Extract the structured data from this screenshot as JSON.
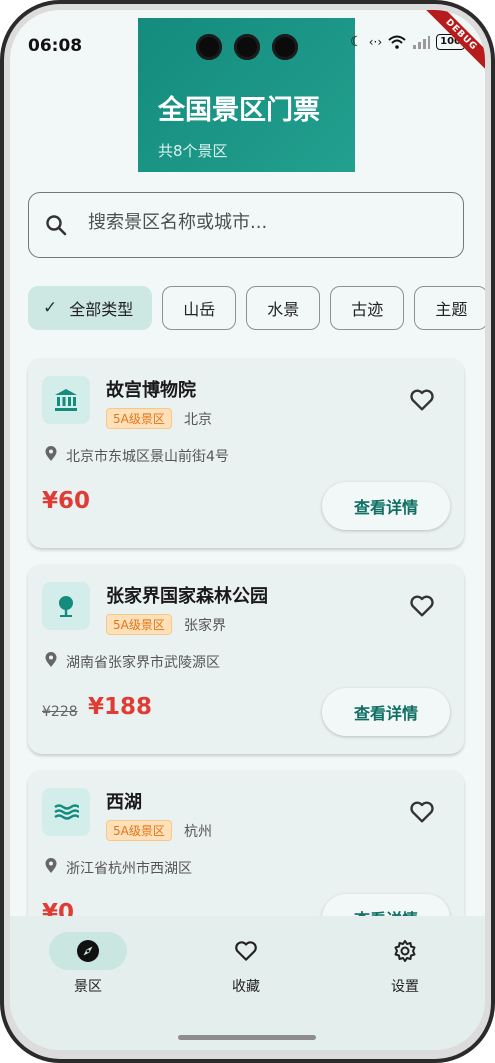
{
  "status_bar": {
    "time": "06:08",
    "battery": "100",
    "debug_label": "DEBUG"
  },
  "header": {
    "title": "全国景区门票",
    "subtitle": "共8个景区"
  },
  "search": {
    "placeholder": "搜索景区名称或城市..."
  },
  "filters": [
    {
      "label": "全部类型",
      "selected": true
    },
    {
      "label": "山岳"
    },
    {
      "label": "水景"
    },
    {
      "label": "古迹"
    },
    {
      "label": "主题"
    }
  ],
  "spots": [
    {
      "name": "故宫博物院",
      "level": "5A级景区",
      "city": "北京",
      "address": "北京市东城区景山前街4号",
      "original_price": "",
      "price": "¥60",
      "button": "查看详情",
      "icon": "museum-icon"
    },
    {
      "name": "张家界国家森林公园",
      "level": "5A级景区",
      "city": "张家界",
      "address": "湖南省张家界市武陵源区",
      "original_price": "¥228",
      "price": "¥188",
      "button": "查看详情",
      "icon": "tree-icon"
    },
    {
      "name": "西湖",
      "level": "5A级景区",
      "city": "杭州",
      "address": "浙江省杭州市西湖区",
      "original_price": "",
      "price": "¥0",
      "button": "查看详情",
      "icon": "water-icon"
    }
  ],
  "bottom_nav": [
    {
      "label": "景区",
      "icon": "compass-icon",
      "active": true
    },
    {
      "label": "收藏",
      "icon": "heart-icon"
    },
    {
      "label": "设置",
      "icon": "gear-icon"
    }
  ],
  "colors": {
    "primary": "#138b7d",
    "price": "#e03c36",
    "badge_bg": "#ffe0b8",
    "badge_text": "#e0761b"
  }
}
